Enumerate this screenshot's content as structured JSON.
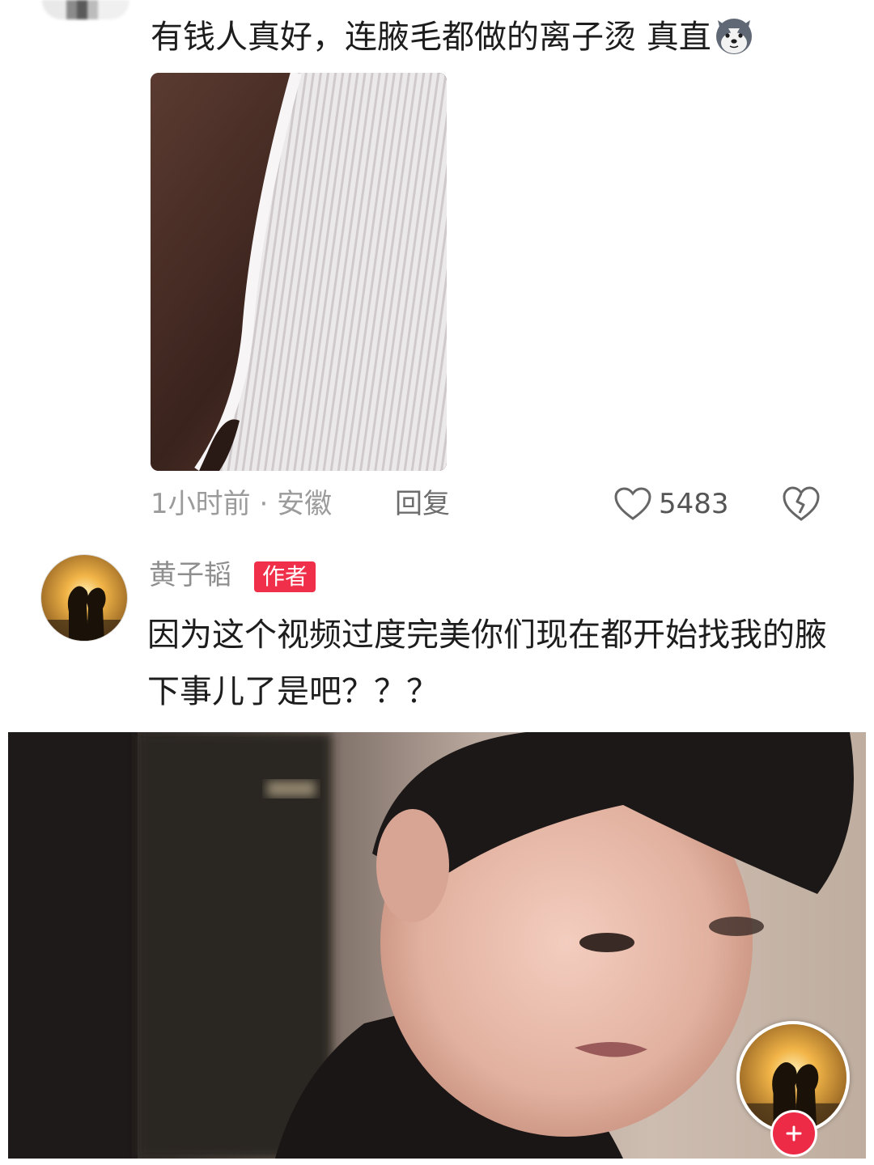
{
  "comment1": {
    "text": "有钱人真好，连腋毛都做的离子烫 真直",
    "emoji": "husky-dog-emoji",
    "time": "1小时前",
    "separator": "·",
    "location": "安徽",
    "reply_label": "回复",
    "like_count": "5483"
  },
  "comment2": {
    "username": "黄子韬",
    "badge": "作者",
    "text": "因为这个视频过度完美你们现在都开始找我的腋下事儿了是吧？？？"
  },
  "colors": {
    "badge_bg": "#f0304a",
    "follow_btn": "#ee2b47",
    "meta_text": "#9b9b9b",
    "body_text": "#1d1d1d"
  }
}
